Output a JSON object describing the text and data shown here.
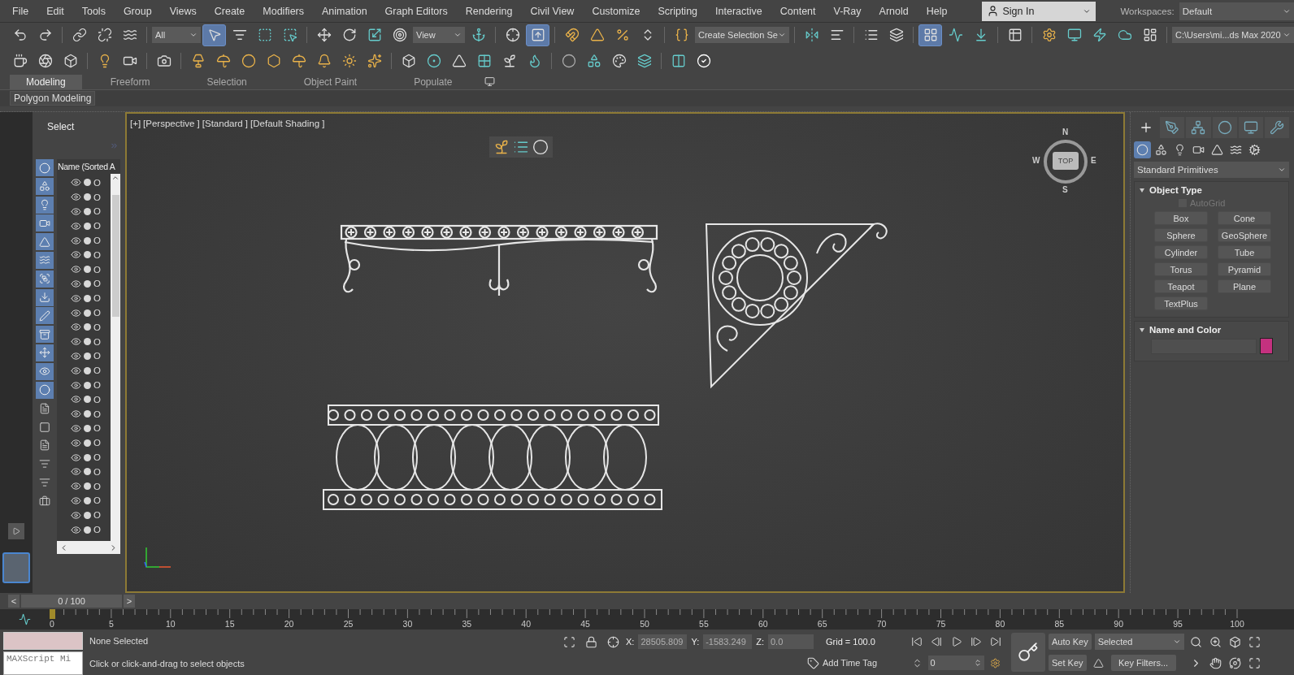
{
  "menu": [
    "File",
    "Edit",
    "Tools",
    "Group",
    "Views",
    "Create",
    "Modifiers",
    "Animation",
    "Graph Editors",
    "Rendering",
    "Civil View",
    "Customize",
    "Scripting",
    "Interactive",
    "Content",
    "V-Ray",
    "Arnold",
    "Help"
  ],
  "account": {
    "label": "Sign In"
  },
  "workspaces": {
    "label": "Workspaces:",
    "value": "Default"
  },
  "main_toolbar": {
    "selection_filter": "All",
    "reference_coordinates": "View",
    "named_selection": "Create Selection Se",
    "project_path": "C:\\Users\\mi...ds Max 2020",
    "buttons": [
      {
        "selected": false
      },
      {
        "selected": false
      },
      {
        "selected": false
      },
      {
        "selected": false
      },
      {
        "selected": false
      },
      {
        "selected": true
      },
      {
        "selected": false
      },
      {
        "selected": false
      },
      {
        "selected": false
      },
      {
        "selected": false
      },
      {
        "selected": false
      },
      {
        "selected": false
      },
      {
        "selected": false
      },
      {
        "selected": false
      },
      {
        "selected": false
      },
      {
        "selected": true
      },
      {
        "selected": false
      },
      {
        "selected": false
      },
      {
        "selected": false
      },
      {
        "selected": false
      },
      {
        "selected": false
      },
      {
        "selected": false
      },
      {
        "selected": false
      },
      {
        "selected": false
      },
      {
        "selected": false
      },
      {
        "selected": true
      },
      {
        "selected": false
      },
      {
        "selected": false
      },
      {
        "selected": false
      },
      {
        "selected": false
      },
      {
        "selected": false
      },
      {
        "selected": false
      },
      {
        "selected": false
      },
      {
        "selected": false
      }
    ]
  },
  "ribbon": {
    "tabs": [
      {
        "label": "Modeling",
        "selected": true
      },
      {
        "label": "Freeform",
        "selected": false
      },
      {
        "label": "Selection",
        "selected": false
      },
      {
        "label": "Object Paint",
        "selected": false
      },
      {
        "label": "Populate",
        "selected": false
      }
    ],
    "panel": "Polygon Modeling"
  },
  "scene_explorer": {
    "title": "Select",
    "column": "Name (Sorted A",
    "filters": [
      {
        "on": true
      },
      {
        "on": true
      },
      {
        "on": true
      },
      {
        "on": true
      },
      {
        "on": true
      },
      {
        "on": true
      },
      {
        "on": true
      },
      {
        "on": true
      },
      {
        "on": true
      },
      {
        "on": true
      },
      {
        "on": true
      },
      {
        "on": true
      },
      {
        "on": true
      }
    ],
    "rows": [
      {
        "name": "O"
      },
      {
        "name": "O"
      },
      {
        "name": "O"
      },
      {
        "name": "O"
      },
      {
        "name": "O"
      },
      {
        "name": "O"
      },
      {
        "name": "O"
      },
      {
        "name": "O"
      },
      {
        "name": "O"
      },
      {
        "name": "O"
      },
      {
        "name": "O"
      },
      {
        "name": "O"
      },
      {
        "name": "O"
      },
      {
        "name": "O"
      },
      {
        "name": "O"
      },
      {
        "name": "O"
      },
      {
        "name": "O"
      },
      {
        "name": "O"
      },
      {
        "name": "O"
      },
      {
        "name": "O"
      },
      {
        "name": "O"
      },
      {
        "name": "O"
      },
      {
        "name": "O"
      },
      {
        "name": "O"
      },
      {
        "name": "O"
      }
    ]
  },
  "viewport": {
    "labels": [
      "[+]",
      "[Perspective ]",
      "[Standard ]",
      "[Default Shading ]"
    ],
    "viewcube": {
      "north": "N",
      "west": "W",
      "east": "E",
      "south": "S",
      "face": "TOP"
    }
  },
  "command_panel": {
    "tabs": [
      {
        "selected": true
      },
      {
        "selected": false
      },
      {
        "selected": false
      },
      {
        "selected": false
      },
      {
        "selected": false
      },
      {
        "selected": false
      }
    ],
    "categories": [
      {
        "selected": true
      },
      {
        "selected": false
      },
      {
        "selected": false
      },
      {
        "selected": false
      },
      {
        "selected": false
      },
      {
        "selected": false
      },
      {
        "selected": false
      }
    ],
    "dropdown": "Standard Primitives",
    "object_type": {
      "title": "Object Type",
      "expanded": true,
      "autogrid": {
        "label": "AutoGrid",
        "checked": false,
        "disabled": true
      },
      "buttons": [
        "Box",
        "Cone",
        "Sphere",
        "GeoSphere",
        "Cylinder",
        "Tube",
        "Torus",
        "Pyramid",
        "Teapot",
        "Plane",
        "TextPlus"
      ]
    },
    "name_and_color": {
      "title": "Name and Color",
      "expanded": true,
      "color": "#c4317f"
    }
  },
  "time_slider": {
    "label": "0 / 100",
    "level": 0,
    "prev": "<",
    "next": ">"
  },
  "track_bar": {
    "ticks": [
      "0",
      "5",
      "10",
      "15",
      "20",
      "25",
      "30",
      "35",
      "40",
      "45",
      "50",
      "55",
      "60",
      "65",
      "70",
      "75",
      "80",
      "85",
      "90",
      "95",
      "100"
    ]
  },
  "status": {
    "maxscript": "MAXScript Mi",
    "selection": "None Selected",
    "prompt": "Click or click-and-drag to select objects",
    "x": {
      "label": "X:",
      "value": "28505.809"
    },
    "y": {
      "label": "Y:",
      "value": "-1583.249"
    },
    "z": {
      "label": "Z:",
      "value": "0.0"
    },
    "grid": "Grid = 100.0",
    "time_tag": "Add Time Tag",
    "frame": "0",
    "auto_key": "Auto Key",
    "key_mode": "Selected",
    "set_key": "Set Key",
    "key_filters": "Key Filters..."
  }
}
